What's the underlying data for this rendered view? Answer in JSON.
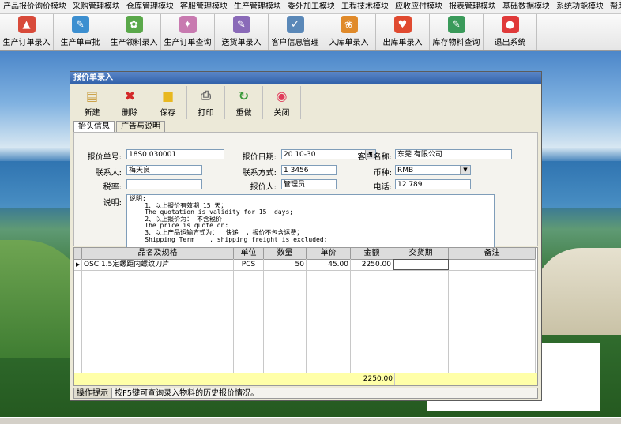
{
  "menu": [
    "产品报价询价模块",
    "采购管理模块",
    "仓库管理模块",
    "客服管理模块",
    "生产管理模块",
    "委外加工模块",
    "工程技术模块",
    "应收应付模块",
    "报表管理模块",
    "基础数据模块",
    "系统功能模块",
    "帮助"
  ],
  "main_toolbar": [
    {
      "label": "生产订单录入",
      "color": "#d84a3a",
      "glyph": "▲",
      "icon": "document-icon"
    },
    {
      "label": "生产单审批",
      "color": "#3c8fd0",
      "glyph": "✎",
      "icon": "approve-icon"
    },
    {
      "label": "生产领料录入",
      "color": "#5aa84a",
      "glyph": "✿",
      "icon": "material-icon"
    },
    {
      "label": "生产订单查询",
      "color": "#c87ab0",
      "glyph": "✦",
      "icon": "query-icon"
    },
    {
      "label": "送货单录入",
      "color": "#8a6ab8",
      "glyph": "✎",
      "icon": "delivery-icon"
    },
    {
      "label": "客户信息管理",
      "color": "#5a88b8",
      "glyph": "✓",
      "icon": "customer-icon"
    },
    {
      "label": "入库单录入",
      "color": "#e08a2a",
      "glyph": "❀",
      "icon": "stock-in-icon"
    },
    {
      "label": "出库单录入",
      "color": "#e04a30",
      "glyph": "♥",
      "icon": "stock-out-icon"
    },
    {
      "label": "库存物料查询",
      "color": "#3a9a5a",
      "glyph": "✎",
      "icon": "inventory-icon"
    },
    {
      "label": "退出系统",
      "color": "#e03a3a",
      "glyph": "●",
      "icon": "exit-icon"
    }
  ],
  "window": {
    "title": "报价单录入",
    "toolbar": [
      {
        "label": "新建",
        "glyph": "▤",
        "color": "#c89a3a",
        "icon": "new-icon"
      },
      {
        "label": "删除",
        "glyph": "✖",
        "color": "#d42a2a",
        "icon": "delete-icon"
      },
      {
        "label": "保存",
        "glyph": "■",
        "color": "#e8b820",
        "icon": "save-icon"
      },
      {
        "label": "打印",
        "glyph": "⎙",
        "color": "#6a6a6a",
        "icon": "print-icon"
      },
      {
        "label": "重做",
        "glyph": "↻",
        "color": "#3a9a3a",
        "icon": "redo-icon"
      },
      {
        "label": "关闭",
        "glyph": "◉",
        "color": "#e03a5a",
        "icon": "close-icon"
      }
    ],
    "tabs": [
      "抬头信息",
      "广告与说明"
    ],
    "form": {
      "quote_no_label": "报价单号:",
      "quote_no": "18S0        030001",
      "date_label": "报价日期:",
      "date": "20      10-30",
      "customer_label": "客户名称:",
      "customer": "东莞               有限公司",
      "contact_label": "联系人:",
      "contact": "梅天良",
      "contact_way_label": "联系方式:",
      "contact_way": "1  3456",
      "currency_label": "币种:",
      "currency": "RMB",
      "tax_label": "税率:",
      "tax": "",
      "quoter_label": "报价人:",
      "quoter": "管理员",
      "phone_label": "电话:",
      "phone": "12      789",
      "notes_label": "说明:",
      "notes": [
        "说明:",
        "    1、以上报价有效期 15 天；",
        "    The quotation is validity for 15  days;",
        "    2、以上报价为： 不含税价",
        "    The price is quote on:",
        "    3、以上产品运输方式为：  快递  ，报价不包含运费；",
        "    Shipping Term    , shipping freight is excluded;"
      ]
    },
    "grid": {
      "headers": [
        "品名及规格",
        "单位",
        "数量",
        "单价",
        "金额",
        "交货期",
        "备注"
      ],
      "rows": [
        {
          "name": "OSC 1.5定螺距内螺纹刀片",
          "unit": "PCS",
          "qty": "50",
          "price": "45.00",
          "amount": "2250.00",
          "delivery": "",
          "remark": ""
        }
      ],
      "total_amount": "2250.00"
    },
    "status": {
      "label": "操作提示",
      "text": "按F5键可查询录入物料的历史报价情况。"
    }
  }
}
